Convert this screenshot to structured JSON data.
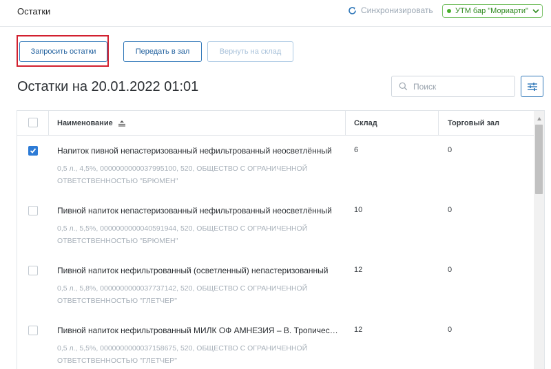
{
  "header": {
    "title": "Остатки",
    "sync_label": "Синхронизировать",
    "utm_label": "УТМ бар \"Мориарти\""
  },
  "toolbar": {
    "request_label": "Запросить остатки",
    "transfer_label": "Передать в зал",
    "return_label": "Вернуть на склад"
  },
  "page": {
    "heading": "Остатки на 20.01.2022 01:01"
  },
  "search": {
    "placeholder": "Поиск",
    "value": ""
  },
  "table": {
    "columns": [
      "Наименование",
      "Склад",
      "Торговый зал"
    ],
    "rows": [
      {
        "checked": true,
        "name": "Напиток пивной непастеризованный нефильтрованный неосветлённый",
        "details": "0,5 л., 4,5%, 0000000000037995100, 520, ОБЩЕСТВО С ОГРАНИЧЕННОЙ ОТВЕТСТВЕННОСТЬЮ \"БРЮМЕН\"",
        "sklad": "6",
        "zal": "0"
      },
      {
        "checked": false,
        "name": "Пивной напиток непастеризованный нефильтрованный неосветлённый",
        "details": "0,5 л., 5,5%, 0000000000040591944, 520, ОБЩЕСТВО С ОГРАНИЧЕННОЙ ОТВЕТСТВЕННОСТЬЮ \"БРЮМЕН\"",
        "sklad": "10",
        "zal": "0"
      },
      {
        "checked": false,
        "name": "Пивной напиток нефильтрованный (осветленный) непастеризованный",
        "details": "0,5 л., 5,8%, 0000000000037737142, 520, ОБЩЕСТВО С ОГРАНИЧЕННОЙ ОТВЕТСТВЕННОСТЬЮ \"ГЛЕТЧЕР\"",
        "sklad": "12",
        "zal": "0"
      },
      {
        "checked": false,
        "name": "Пивной напиток нефильтрованный МИЛК ОФ АМНЕЗИЯ – В. Тропический",
        "details": "0,5 л., 5,5%, 0000000000037158675, 520, ОБЩЕСТВО С ОГРАНИЧЕННОЙ ОТВЕТСТВЕННОСТЬЮ \"ГЛЕТЧЕР\"",
        "sklad": "12",
        "zal": "0"
      }
    ]
  },
  "colors": {
    "accent": "#2e76b8",
    "checkbox_checked": "#2d7bd6",
    "status_green": "#49b02d",
    "highlight_red": "#d2202f",
    "muted_text": "#a7b0b9"
  },
  "icons": {
    "sync": "sync-icon",
    "search": "search-icon",
    "filter": "sliders-icon",
    "sort": "sort-ascending-icon",
    "dropdown": "chevron-down-icon"
  }
}
